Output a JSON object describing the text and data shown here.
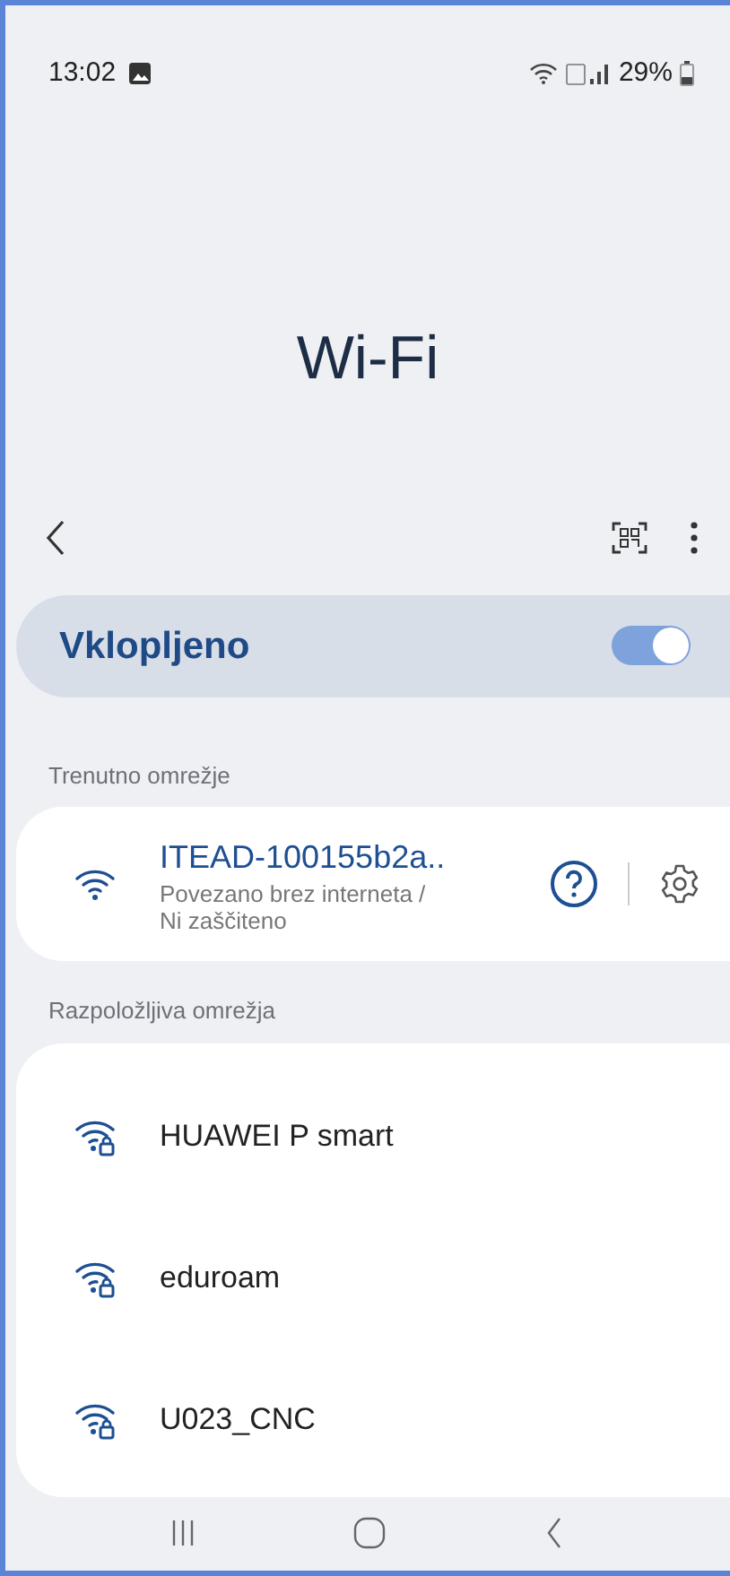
{
  "status_bar": {
    "time": "13:02",
    "battery": "29%"
  },
  "title": "Wi-Fi",
  "master_switch": {
    "label": "Vklopljeno",
    "on": true
  },
  "current_network": {
    "header": "Trenutno omrežje",
    "name": "ITEAD-100155b2a..",
    "status": "Povezano brez interneta / Ni zaščiteno"
  },
  "available_networks": {
    "header": "Razpoložljiva omrežja",
    "items": [
      {
        "name": "HUAWEI P smart",
        "secured": true
      },
      {
        "name": "eduroam",
        "secured": true
      },
      {
        "name": "U023_CNC",
        "secured": true
      }
    ]
  }
}
